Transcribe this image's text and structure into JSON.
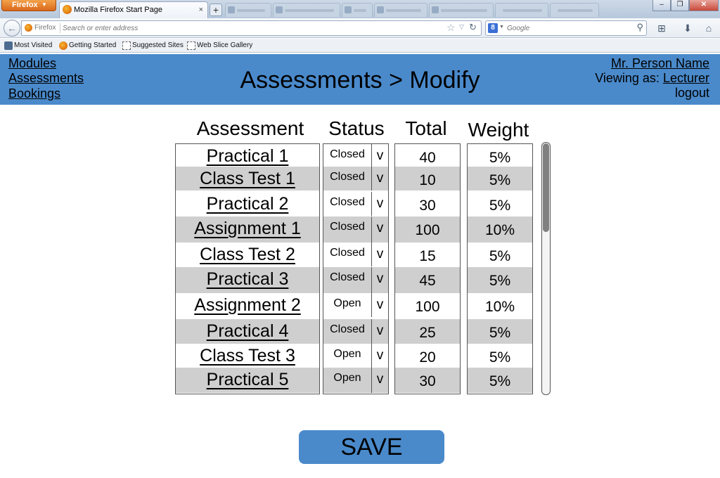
{
  "browser": {
    "app_button": "Firefox",
    "active_tab_title": "Mozilla Firefox Start Page",
    "new_tab_symbol": "+",
    "url_identity": "Firefox",
    "url_placeholder": "Search or enter address",
    "search_engine_letter": "8",
    "search_placeholder": "Google",
    "bookmarks": [
      "Most Visited",
      "Getting Started",
      "Suggested Sites",
      "Web Slice Gallery"
    ]
  },
  "header": {
    "nav": [
      "Modules",
      "Assessments",
      "Bookings"
    ],
    "title": "Assessments > Modify",
    "user_name": "Mr. Person Name",
    "viewing_as_label": "Viewing as:",
    "role": "Lecturer",
    "logout": "logout"
  },
  "table": {
    "columns": [
      "Assessment",
      "Status",
      "Total",
      "Weight"
    ],
    "dropdown_symbol": "v",
    "rows": [
      {
        "name": "Practical 1",
        "status": "Closed",
        "total": "40",
        "weight": "5%"
      },
      {
        "name": "Class Test 1",
        "status": "Closed",
        "total": "10",
        "weight": "5%"
      },
      {
        "name": "Practical 2",
        "status": "Closed",
        "total": "30",
        "weight": "5%"
      },
      {
        "name": "Assignment 1",
        "status": "Closed",
        "total": "100",
        "weight": "10%"
      },
      {
        "name": "Class Test 2",
        "status": "Closed",
        "total": "15",
        "weight": "5%"
      },
      {
        "name": "Practical 3",
        "status": "Closed",
        "total": "45",
        "weight": "5%"
      },
      {
        "name": "Assignment 2",
        "status": "Open",
        "total": "100",
        "weight": "10%"
      },
      {
        "name": "Practical 4",
        "status": "Closed",
        "total": "25",
        "weight": "5%"
      },
      {
        "name": "Class Test 3",
        "status": "Open",
        "total": "20",
        "weight": "5%"
      },
      {
        "name": "Practical 5",
        "status": "Open",
        "total": "30",
        "weight": "5%"
      }
    ]
  },
  "save_label": "SAVE",
  "colors": {
    "header_bg": "#4a8acb",
    "row_alt": "#cfcfcf"
  }
}
